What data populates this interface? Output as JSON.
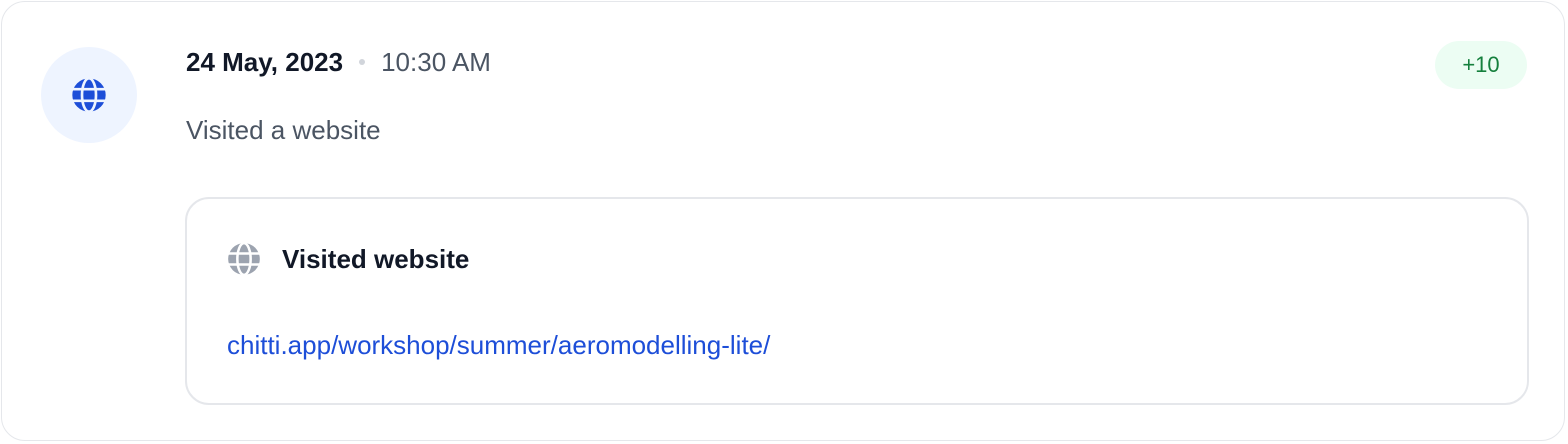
{
  "activity": {
    "icon": "globe-icon",
    "date": "24 May, 2023",
    "time": "10:30 AM",
    "points": "+10",
    "description": "Visited a website",
    "detail": {
      "icon": "globe-icon",
      "title": "Visited website",
      "url": "chitti.app/workshop/summer/aeromodelling-lite/"
    }
  },
  "colors": {
    "accent_blue": "#1d4ed8",
    "avatar_bg": "#eef4ff",
    "points_bg": "#ecfdf3",
    "points_text": "#15803d",
    "muted_icon": "#9ca3af"
  }
}
